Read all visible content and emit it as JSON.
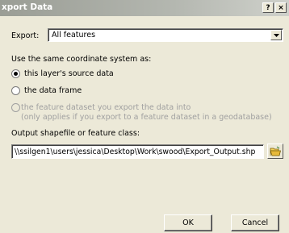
{
  "window": {
    "title": "xport Data",
    "help_label": "?",
    "close_label": "×"
  },
  "export": {
    "label": "Export:",
    "selected": "All features"
  },
  "coordinate_system": {
    "heading": "Use the same coordinate system as:",
    "options": [
      {
        "label": "this layer's source data",
        "checked": true,
        "enabled": true
      },
      {
        "label": "the data frame",
        "checked": false,
        "enabled": true
      },
      {
        "label": "the feature dataset you export the data into",
        "sublabel": "(only applies if you export to a feature dataset in a geodatabase)",
        "checked": false,
        "enabled": false
      }
    ]
  },
  "output": {
    "label": "Output shapefile or feature class:",
    "value": "\\\\ssilgen1\\users\\jessica\\Desktop\\Work\\swood\\Export_Output.shp"
  },
  "buttons": {
    "ok": "OK",
    "cancel": "Cancel"
  },
  "icons": {
    "browse": "open-folder-icon",
    "dropdown": "chevron-down-icon"
  }
}
